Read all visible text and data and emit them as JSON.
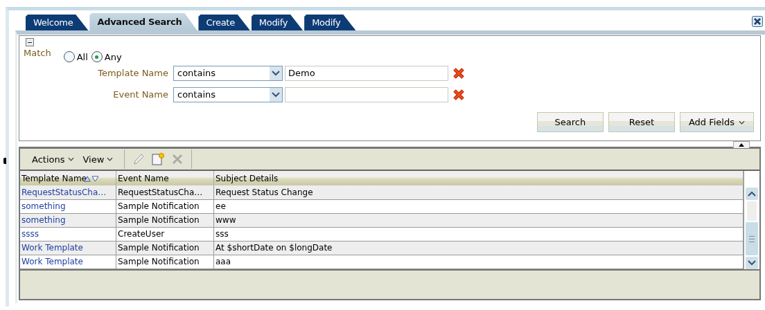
{
  "tabs": [
    {
      "label": "Welcome",
      "selected": false
    },
    {
      "label": "Advanced Search",
      "selected": true
    },
    {
      "label": "Create",
      "selected": false
    },
    {
      "label": "Modify",
      "selected": false
    },
    {
      "label": "Modify",
      "selected": false
    }
  ],
  "search": {
    "match_label": "Match",
    "match_options": [
      {
        "label": "All",
        "selected": false
      },
      {
        "label": "Any",
        "selected": true
      }
    ],
    "criteria": [
      {
        "label": "Template Name",
        "operator": "contains",
        "value": "Demo"
      },
      {
        "label": "Event Name",
        "operator": "contains"
      }
    ],
    "buttons": [
      {
        "label": "Search",
        "kind": "plain"
      },
      {
        "label": "Reset",
        "kind": "plain"
      },
      {
        "label": "Add Fields",
        "kind": "menu"
      }
    ]
  },
  "toolbar": {
    "menus": [
      "Actions",
      "View"
    ]
  },
  "table": {
    "columns": [
      {
        "label": "Template Name",
        "sortable": true
      },
      {
        "label": "Event Name",
        "sortable": false
      },
      {
        "label": "Subject Details",
        "sortable": false
      }
    ],
    "rows": [
      [
        "RequestStatusCha…",
        "RequestStatusCha…",
        "Request Status Change"
      ],
      [
        "something",
        "Sample Notification",
        "ee"
      ],
      [
        "something",
        "Sample Notification",
        "www"
      ],
      [
        "ssss",
        "CreateUser",
        "sss"
      ],
      [
        "Work Template",
        "Sample Notification",
        "At $shortDate on $longDate"
      ],
      [
        "Work Template",
        "Sample Notification",
        "aaa"
      ]
    ]
  }
}
